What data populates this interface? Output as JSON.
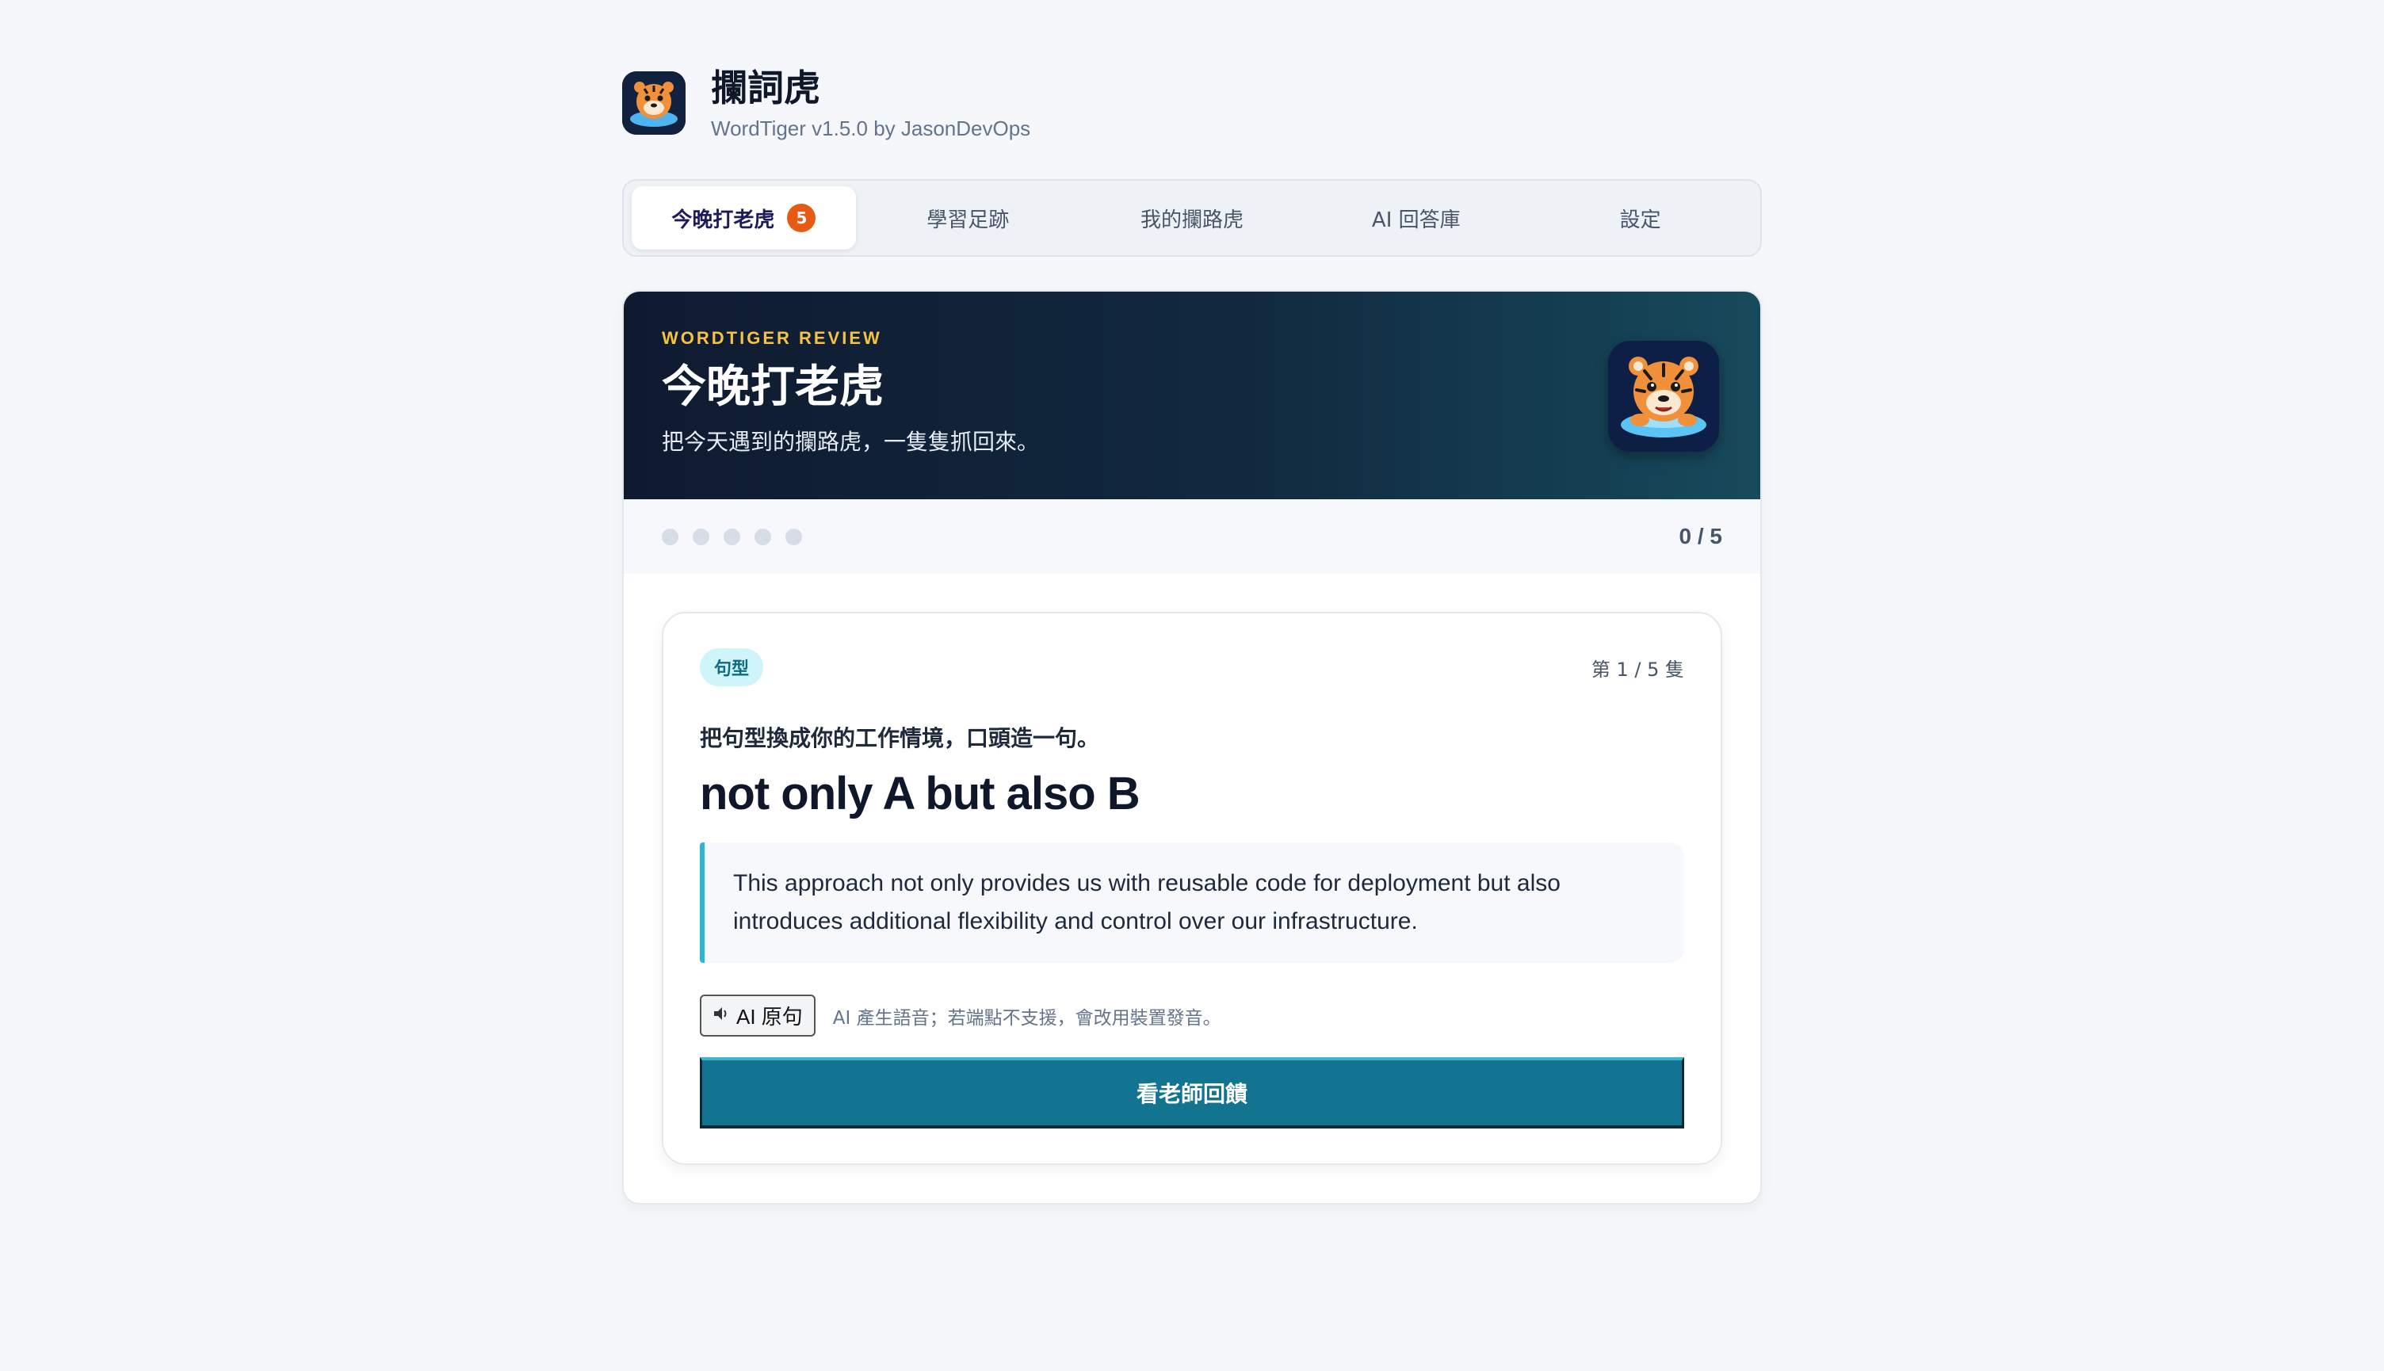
{
  "app": {
    "title": "攔詞虎",
    "subtitle": "WordTiger v1.5.0 by JasonDevOps",
    "logo_icon": "tiger-logo-icon"
  },
  "tabs": [
    {
      "label": "今晚打老虎",
      "badge": "5",
      "active": true
    },
    {
      "label": "學習足跡"
    },
    {
      "label": "我的攔路虎"
    },
    {
      "label": "AI 回答庫"
    },
    {
      "label": "設定"
    }
  ],
  "hero": {
    "eyebrow": "WORDTIGER REVIEW",
    "title": "今晚打老虎",
    "description": "把今天遇到的攔路虎，一隻隻抓回來。",
    "mascot_icon": "tiger-mascot-icon"
  },
  "progress": {
    "done": 0,
    "total": 5,
    "label": "0 / 5"
  },
  "question": {
    "tag": "句型",
    "index_label": "第 1 / 5 隻",
    "prompt": "把句型換成你的工作情境，口頭造一句。",
    "pattern": "not only A but also B",
    "example": "This approach not only provides us with reusable code for deployment but also introduces additional flexibility and control over our infrastructure.",
    "audio_button_label": "AI 原句",
    "audio_icon": "speaker-icon",
    "audio_hint": "AI 產生語音；若端點不支援，會改用裝置發音。",
    "feedback_button_label": "看老師回饋"
  },
  "colors": {
    "accent": "#127491",
    "badge": "#e65a14",
    "eyebrow": "#f6c243",
    "tag_bg": "#cff5fb"
  }
}
